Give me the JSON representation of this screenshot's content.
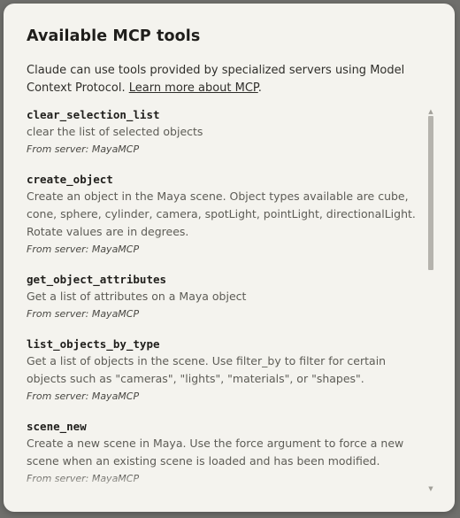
{
  "dialog": {
    "title": "Available MCP tools",
    "description_text": "Claude can use tools provided by specialized servers using Model Context Protocol. ",
    "description_link": "Learn more about MCP",
    "description_end": "."
  },
  "tools": [
    {
      "name": "clear_selection_list",
      "description": "clear the list of selected objects",
      "server_prefix": "From server: ",
      "server": "MayaMCP"
    },
    {
      "name": "create_object",
      "description": "Create an object in the Maya scene. Object types available are cube, cone, sphere, cylinder, camera, spotLight, pointLight, directionalLight. Rotate values are in degrees.",
      "server_prefix": "From server: ",
      "server": "MayaMCP"
    },
    {
      "name": "get_object_attributes",
      "description": "Get a list of attributes on a Maya object",
      "server_prefix": "From server: ",
      "server": "MayaMCP"
    },
    {
      "name": "list_objects_by_type",
      "description": "Get a list of objects in the scene. Use filter_by to filter for certain objects such as \"cameras\", \"lights\", \"materials\", or \"shapes\".",
      "server_prefix": "From server: ",
      "server": "MayaMCP"
    },
    {
      "name": "scene_new",
      "description": "Create a new scene in Maya. Use the force argument to force a new scene when an existing scene is loaded and has been modified.",
      "server_prefix": "From server: ",
      "server": "MayaMCP"
    }
  ],
  "scrollbar": {
    "up_arrow": "▲",
    "down_arrow": "▼",
    "position_fraction": 0.0
  },
  "colors": {
    "dialog_bg": "#f4f3ee",
    "backdrop": "#6f6f6c",
    "title": "#1f1e1b",
    "muted_text": "#5d5c56"
  }
}
